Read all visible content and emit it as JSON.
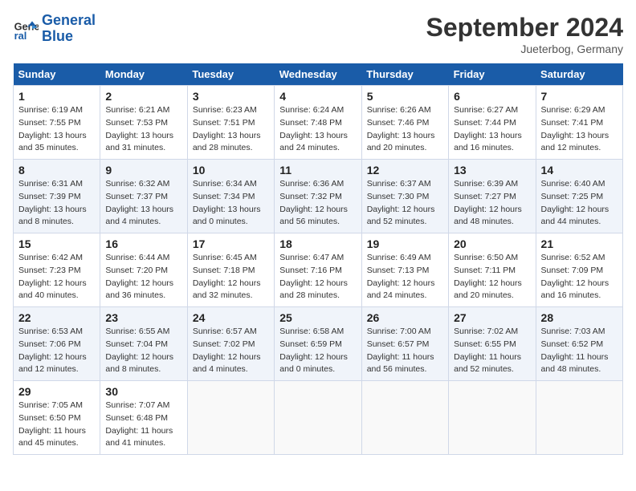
{
  "header": {
    "logo_line1": "General",
    "logo_line2": "Blue",
    "month_title": "September 2024",
    "location": "Jueterbog, Germany"
  },
  "weekdays": [
    "Sunday",
    "Monday",
    "Tuesday",
    "Wednesday",
    "Thursday",
    "Friday",
    "Saturday"
  ],
  "weeks": [
    [
      {
        "day": "1",
        "sunrise": "Sunrise: 6:19 AM",
        "sunset": "Sunset: 7:55 PM",
        "daylight": "Daylight: 13 hours and 35 minutes."
      },
      {
        "day": "2",
        "sunrise": "Sunrise: 6:21 AM",
        "sunset": "Sunset: 7:53 PM",
        "daylight": "Daylight: 13 hours and 31 minutes."
      },
      {
        "day": "3",
        "sunrise": "Sunrise: 6:23 AM",
        "sunset": "Sunset: 7:51 PM",
        "daylight": "Daylight: 13 hours and 28 minutes."
      },
      {
        "day": "4",
        "sunrise": "Sunrise: 6:24 AM",
        "sunset": "Sunset: 7:48 PM",
        "daylight": "Daylight: 13 hours and 24 minutes."
      },
      {
        "day": "5",
        "sunrise": "Sunrise: 6:26 AM",
        "sunset": "Sunset: 7:46 PM",
        "daylight": "Daylight: 13 hours and 20 minutes."
      },
      {
        "day": "6",
        "sunrise": "Sunrise: 6:27 AM",
        "sunset": "Sunset: 7:44 PM",
        "daylight": "Daylight: 13 hours and 16 minutes."
      },
      {
        "day": "7",
        "sunrise": "Sunrise: 6:29 AM",
        "sunset": "Sunset: 7:41 PM",
        "daylight": "Daylight: 13 hours and 12 minutes."
      }
    ],
    [
      {
        "day": "8",
        "sunrise": "Sunrise: 6:31 AM",
        "sunset": "Sunset: 7:39 PM",
        "daylight": "Daylight: 13 hours and 8 minutes."
      },
      {
        "day": "9",
        "sunrise": "Sunrise: 6:32 AM",
        "sunset": "Sunset: 7:37 PM",
        "daylight": "Daylight: 13 hours and 4 minutes."
      },
      {
        "day": "10",
        "sunrise": "Sunrise: 6:34 AM",
        "sunset": "Sunset: 7:34 PM",
        "daylight": "Daylight: 13 hours and 0 minutes."
      },
      {
        "day": "11",
        "sunrise": "Sunrise: 6:36 AM",
        "sunset": "Sunset: 7:32 PM",
        "daylight": "Daylight: 12 hours and 56 minutes."
      },
      {
        "day": "12",
        "sunrise": "Sunrise: 6:37 AM",
        "sunset": "Sunset: 7:30 PM",
        "daylight": "Daylight: 12 hours and 52 minutes."
      },
      {
        "day": "13",
        "sunrise": "Sunrise: 6:39 AM",
        "sunset": "Sunset: 7:27 PM",
        "daylight": "Daylight: 12 hours and 48 minutes."
      },
      {
        "day": "14",
        "sunrise": "Sunrise: 6:40 AM",
        "sunset": "Sunset: 7:25 PM",
        "daylight": "Daylight: 12 hours and 44 minutes."
      }
    ],
    [
      {
        "day": "15",
        "sunrise": "Sunrise: 6:42 AM",
        "sunset": "Sunset: 7:23 PM",
        "daylight": "Daylight: 12 hours and 40 minutes."
      },
      {
        "day": "16",
        "sunrise": "Sunrise: 6:44 AM",
        "sunset": "Sunset: 7:20 PM",
        "daylight": "Daylight: 12 hours and 36 minutes."
      },
      {
        "day": "17",
        "sunrise": "Sunrise: 6:45 AM",
        "sunset": "Sunset: 7:18 PM",
        "daylight": "Daylight: 12 hours and 32 minutes."
      },
      {
        "day": "18",
        "sunrise": "Sunrise: 6:47 AM",
        "sunset": "Sunset: 7:16 PM",
        "daylight": "Daylight: 12 hours and 28 minutes."
      },
      {
        "day": "19",
        "sunrise": "Sunrise: 6:49 AM",
        "sunset": "Sunset: 7:13 PM",
        "daylight": "Daylight: 12 hours and 24 minutes."
      },
      {
        "day": "20",
        "sunrise": "Sunrise: 6:50 AM",
        "sunset": "Sunset: 7:11 PM",
        "daylight": "Daylight: 12 hours and 20 minutes."
      },
      {
        "day": "21",
        "sunrise": "Sunrise: 6:52 AM",
        "sunset": "Sunset: 7:09 PM",
        "daylight": "Daylight: 12 hours and 16 minutes."
      }
    ],
    [
      {
        "day": "22",
        "sunrise": "Sunrise: 6:53 AM",
        "sunset": "Sunset: 7:06 PM",
        "daylight": "Daylight: 12 hours and 12 minutes."
      },
      {
        "day": "23",
        "sunrise": "Sunrise: 6:55 AM",
        "sunset": "Sunset: 7:04 PM",
        "daylight": "Daylight: 12 hours and 8 minutes."
      },
      {
        "day": "24",
        "sunrise": "Sunrise: 6:57 AM",
        "sunset": "Sunset: 7:02 PM",
        "daylight": "Daylight: 12 hours and 4 minutes."
      },
      {
        "day": "25",
        "sunrise": "Sunrise: 6:58 AM",
        "sunset": "Sunset: 6:59 PM",
        "daylight": "Daylight: 12 hours and 0 minutes."
      },
      {
        "day": "26",
        "sunrise": "Sunrise: 7:00 AM",
        "sunset": "Sunset: 6:57 PM",
        "daylight": "Daylight: 11 hours and 56 minutes."
      },
      {
        "day": "27",
        "sunrise": "Sunrise: 7:02 AM",
        "sunset": "Sunset: 6:55 PM",
        "daylight": "Daylight: 11 hours and 52 minutes."
      },
      {
        "day": "28",
        "sunrise": "Sunrise: 7:03 AM",
        "sunset": "Sunset: 6:52 PM",
        "daylight": "Daylight: 11 hours and 48 minutes."
      }
    ],
    [
      {
        "day": "29",
        "sunrise": "Sunrise: 7:05 AM",
        "sunset": "Sunset: 6:50 PM",
        "daylight": "Daylight: 11 hours and 45 minutes."
      },
      {
        "day": "30",
        "sunrise": "Sunrise: 7:07 AM",
        "sunset": "Sunset: 6:48 PM",
        "daylight": "Daylight: 11 hours and 41 minutes."
      },
      null,
      null,
      null,
      null,
      null
    ]
  ]
}
